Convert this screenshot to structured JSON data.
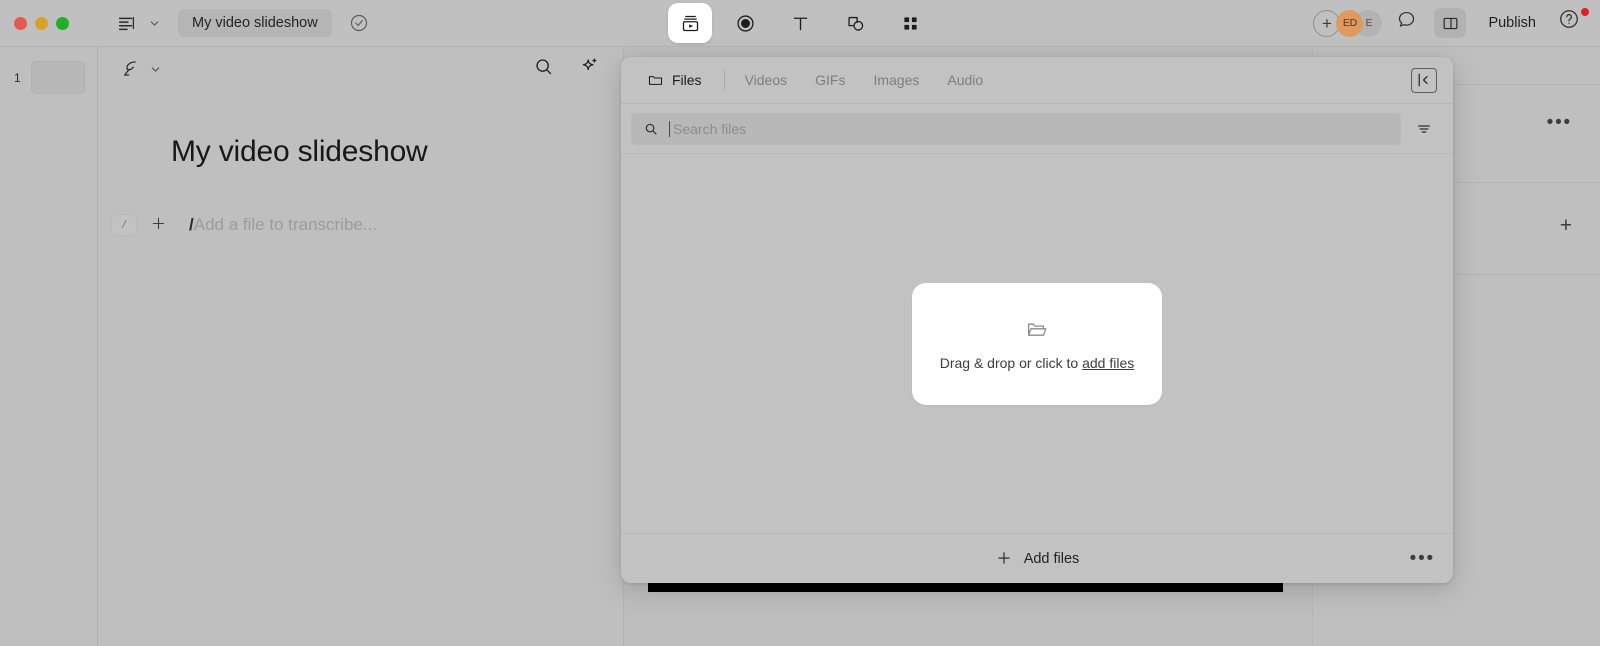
{
  "window": {
    "traffic_lights": [
      "close",
      "minimize",
      "zoom"
    ],
    "colors": {
      "close": "#e05a4f",
      "minimize": "#d8a128",
      "zoom": "#1db028",
      "avatar_accent": "#e09a5e",
      "notification": "#e02020"
    }
  },
  "topbar": {
    "sidebar_toggle_icon": "sidebar-lines-icon",
    "sidebar_chevron_icon": "chevron-down-icon",
    "document_title": "My video slideshow",
    "saved_status_icon": "check-circle-icon",
    "center_tools": [
      {
        "name": "media-slideshow-tool",
        "icon": "media-player-icon",
        "active": true
      },
      {
        "name": "record-tool",
        "icon": "record-circle-icon",
        "active": false
      },
      {
        "name": "text-tool",
        "icon": "text-t-icon",
        "active": false
      },
      {
        "name": "shapes-tool",
        "icon": "shapes-icon",
        "active": false
      },
      {
        "name": "grid-tool",
        "icon": "grid-four-icon",
        "active": false
      }
    ],
    "invite_label": "+",
    "avatars": [
      {
        "initials": "ED",
        "color": "#e09a5e"
      },
      {
        "initials": "E",
        "color": "#b3b3b3"
      }
    ],
    "comment_icon": "comment-bubble-icon",
    "panel_toggle_icon": "right-panel-icon",
    "publish_label": "Publish",
    "help_icon": "question-circle-icon",
    "help_has_badge": true
  },
  "slide_rail": {
    "slides": [
      {
        "number": "1"
      }
    ]
  },
  "editor": {
    "quill_icon": "quill-pen-icon",
    "quill_chevron_icon": "chevron-down-icon",
    "search_icon": "search-icon",
    "ai_icon": "sparkle-ai-icon",
    "heading": "My video slideshow",
    "slash_chip_label": "/",
    "add_block_icon": "plus-icon",
    "placeholder_slash": "/",
    "placeholder_text": "Add a file to transcribe..."
  },
  "right_rail": {
    "more_icon": "more-horizontal-icon",
    "add_icon": "plus-icon"
  },
  "media_panel": {
    "tabs": [
      {
        "label": "Files",
        "icon": "folder-icon",
        "active": true
      },
      {
        "label": "Videos",
        "icon": null,
        "active": false
      },
      {
        "label": "GIFs",
        "icon": null,
        "active": false
      },
      {
        "label": "Images",
        "icon": null,
        "active": false
      },
      {
        "label": "Audio",
        "icon": null,
        "active": false
      }
    ],
    "collapse_icon": "collapse-panel-left-icon",
    "search": {
      "icon": "search-icon",
      "placeholder": "Search files",
      "value": ""
    },
    "filter_icon": "filter-lines-icon",
    "dropzone": {
      "icon": "folder-open-icon",
      "text_prefix": "Drag & drop or click to ",
      "link_label": "add files"
    },
    "footer": {
      "add_files_label": "Add files",
      "add_files_icon": "plus-icon",
      "more_icon": "more-horizontal-icon"
    }
  }
}
